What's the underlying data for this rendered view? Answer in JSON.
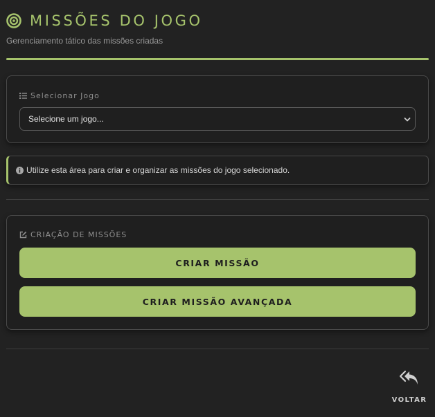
{
  "header": {
    "title": "MISSÕES DO JOGO",
    "subtitle": "Gerenciamento tático das missões criadas",
    "icon": "target-icon"
  },
  "game_select": {
    "label": "Selecionar Jogo",
    "label_icon": "list-icon",
    "selected_value": "Selecione um jogo...",
    "chevron_icon": "chevron-down-icon"
  },
  "info": {
    "icon": "info-circle-icon",
    "text": "Utilize esta área para criar e organizar as missões do jogo selecionado."
  },
  "creation": {
    "label": "CRIAÇÃO DE MISSÕES",
    "label_icon": "edit-icon",
    "buttons": [
      {
        "label": "CRIAR MISSÃO"
      },
      {
        "label": "CRIAR MISSÃO AVANÇADA"
      }
    ]
  },
  "back": {
    "label": "VOLTAR",
    "icon": "reply-all-icon"
  },
  "colors": {
    "accent": "#a6c36c",
    "background": "#222222",
    "card_border": "#4a4a4a"
  }
}
